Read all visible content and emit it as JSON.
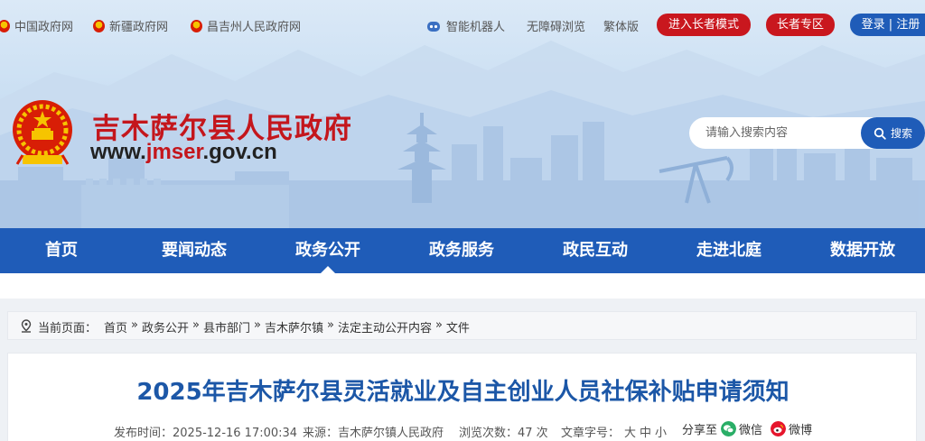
{
  "top_links": [
    {
      "label": "中国政府网"
    },
    {
      "label": "新疆政府网"
    },
    {
      "label": "昌吉州人民政府网"
    }
  ],
  "tools": {
    "robot": "智能机器人",
    "accessible": "无障碍浏览",
    "traditional": "繁体版",
    "elder_mode": "进入长者模式",
    "elder_zone": "长者专区",
    "login": "登录 | 注册"
  },
  "site": {
    "title": "吉木萨尔县人民政府",
    "url_prefix": "www.",
    "url_domain": "jmser",
    "url_suffix": ".gov.cn"
  },
  "search": {
    "placeholder": "请输入搜索内容",
    "button": "搜索"
  },
  "nav": [
    {
      "label": "首页"
    },
    {
      "label": "要闻动态"
    },
    {
      "label": "政务公开"
    },
    {
      "label": "政务服务"
    },
    {
      "label": "政民互动"
    },
    {
      "label": "走进北庭"
    },
    {
      "label": "数据开放"
    }
  ],
  "breadcrumb": {
    "label": "当前页面：",
    "items": [
      "首页",
      "政务公开",
      "县市部门",
      "吉木萨尔镇",
      "法定主动公开内容",
      "文件"
    ],
    "separator": "»"
  },
  "article": {
    "title": "2025年吉木萨尔县灵活就业及自主创业人员社保补贴申请须知",
    "publish_time": "发布时间：2025-12-16 17:00:34",
    "source": "来源：吉木萨尔镇人民政府",
    "views": "浏览次数：47 次",
    "font_size_label": "文章字号：",
    "font_sizes": [
      "大",
      "中",
      "小"
    ],
    "share_label": "分享至",
    "share_wechat": "微信",
    "share_weibo": "微博"
  },
  "colors": {
    "brand_blue": "#1f5cb8",
    "brand_red": "#c4161c",
    "title_blue": "#1c57a7"
  },
  "icons": [
    "emblem-icon",
    "robot-icon",
    "search-icon",
    "location-icon",
    "wechat-icon",
    "weibo-icon"
  ]
}
